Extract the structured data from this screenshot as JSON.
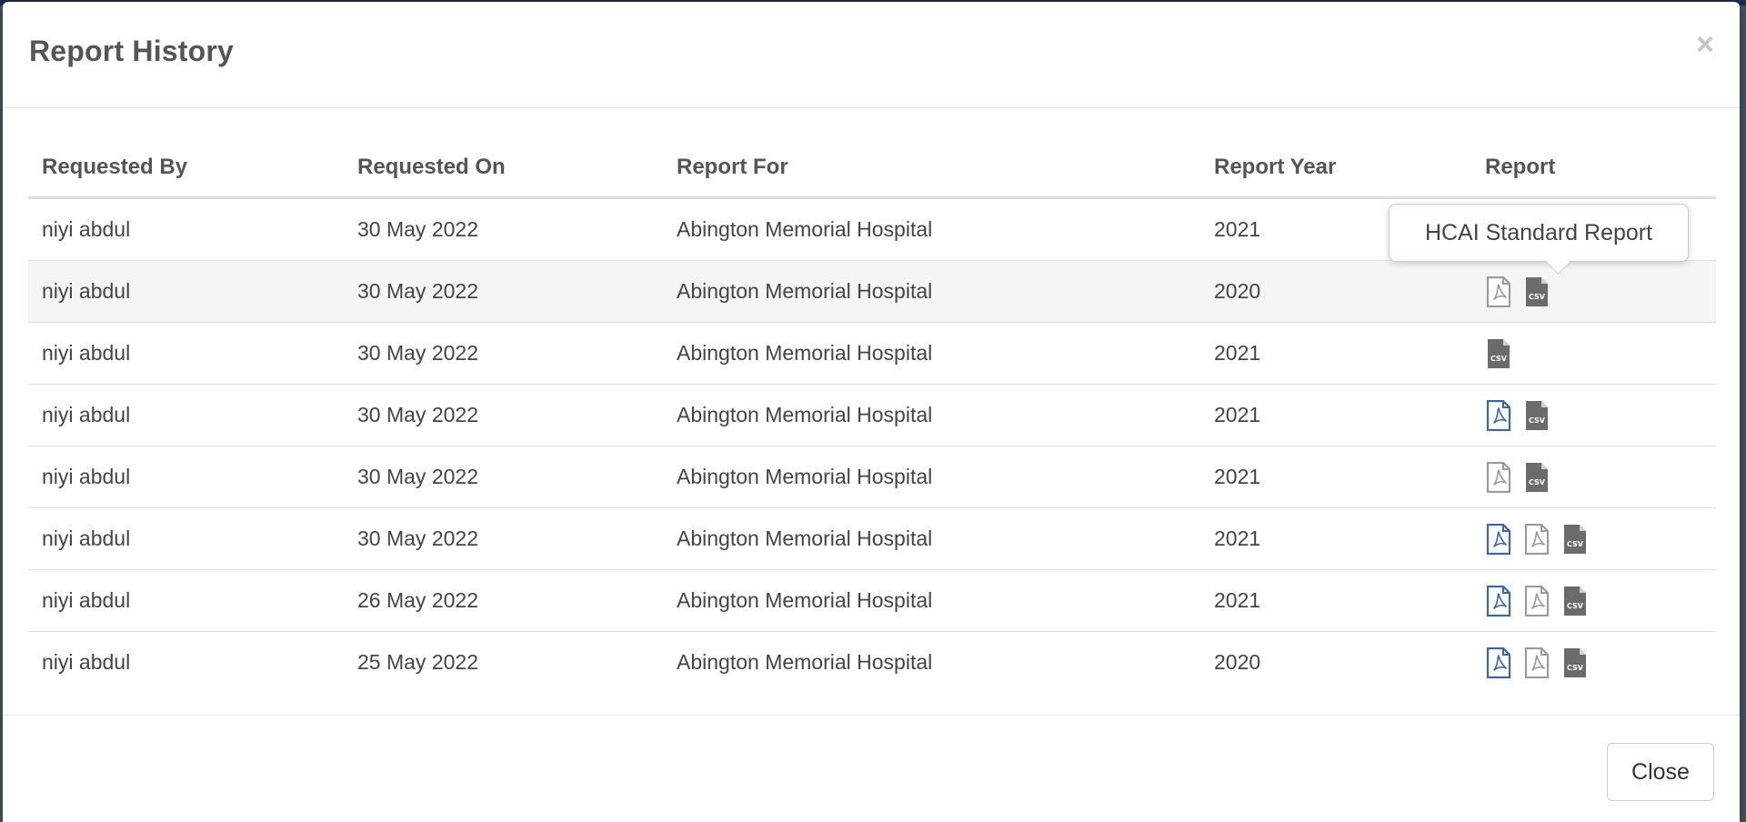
{
  "modal": {
    "title": "Report History",
    "close_symbol": "×",
    "close_button_label": "Close"
  },
  "table": {
    "headers": [
      "Requested By",
      "Requested On",
      "Report For",
      "Report Year",
      "Report"
    ],
    "rows": [
      {
        "by": "niyi abdul",
        "on": "30 May 2022",
        "for": "Abington Memorial Hospital",
        "year": "2021",
        "icons": []
      },
      {
        "by": "niyi abdul",
        "on": "30 May 2022",
        "for": "Abington Memorial Hospital",
        "year": "2020",
        "icons": [
          "pdf-gray-icon",
          "csv-icon"
        ]
      },
      {
        "by": "niyi abdul",
        "on": "30 May 2022",
        "for": "Abington Memorial Hospital",
        "year": "2021",
        "icons": [
          "csv-icon"
        ]
      },
      {
        "by": "niyi abdul",
        "on": "30 May 2022",
        "for": "Abington Memorial Hospital",
        "year": "2021",
        "icons": [
          "pdf-blue-icon",
          "csv-icon"
        ]
      },
      {
        "by": "niyi abdul",
        "on": "30 May 2022",
        "for": "Abington Memorial Hospital",
        "year": "2021",
        "icons": [
          "pdf-gray-icon",
          "csv-icon"
        ]
      },
      {
        "by": "niyi abdul",
        "on": "30 May 2022",
        "for": "Abington Memorial Hospital",
        "year": "2021",
        "icons": [
          "pdf-blue-icon",
          "pdf-gray-icon",
          "csv-icon"
        ]
      },
      {
        "by": "niyi abdul",
        "on": "26 May 2022",
        "for": "Abington Memorial Hospital",
        "year": "2021",
        "icons": [
          "pdf-blue-icon",
          "pdf-gray-icon",
          "csv-icon"
        ]
      },
      {
        "by": "niyi abdul",
        "on": "25 May 2022",
        "for": "Abington Memorial Hospital",
        "year": "2020",
        "icons": [
          "pdf-blue-icon",
          "pdf-gray-icon",
          "csv-icon"
        ]
      }
    ]
  },
  "tooltip": {
    "text": "HCAI Standard Report"
  },
  "colors": {
    "pdf_blue": "#3a64b0",
    "pdf_gray": "#9a9a9a",
    "csv_gray": "#6b6b6b",
    "hover_row": "#f5f5f5"
  }
}
